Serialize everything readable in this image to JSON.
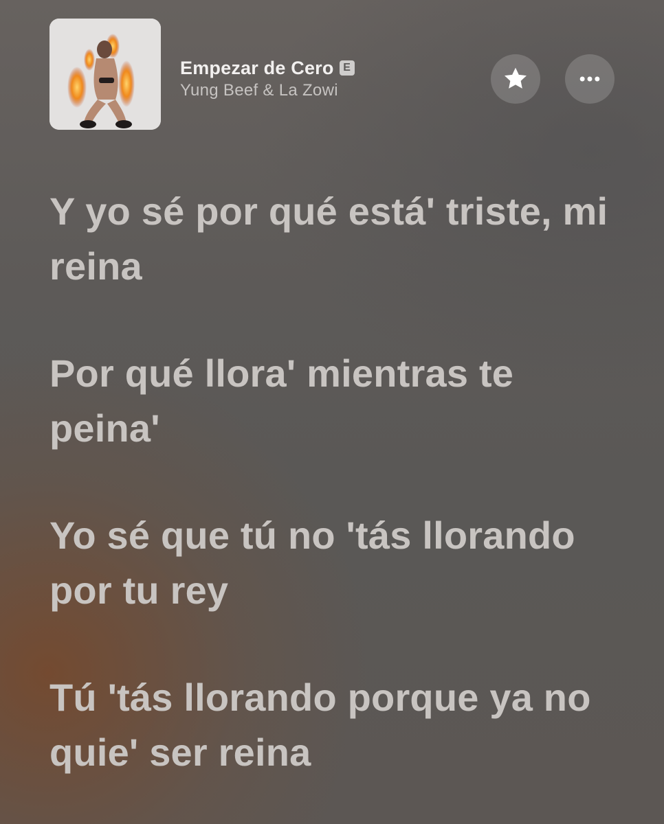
{
  "now_playing": {
    "title": "Empezar de Cero",
    "explicit_badge": "E",
    "artist": "Yung Beef & La Zowi",
    "favorite_icon": "star-icon",
    "more_icon": "ellipsis-icon"
  },
  "lyrics": [
    "Y yo sé por qué está' triste, mi reina",
    "Por qué llora' mientras te peina'",
    "Yo sé que tú no 'tás llorando por tu rey",
    "Tú 'tás llorando porque ya no quie' ser reina"
  ],
  "colors": {
    "lyric_text": "#c8c4c1",
    "title_text": "#f2f0ef",
    "artist_text": "#c6c3c1",
    "button_bg": "rgba(255,255,255,0.17)"
  }
}
